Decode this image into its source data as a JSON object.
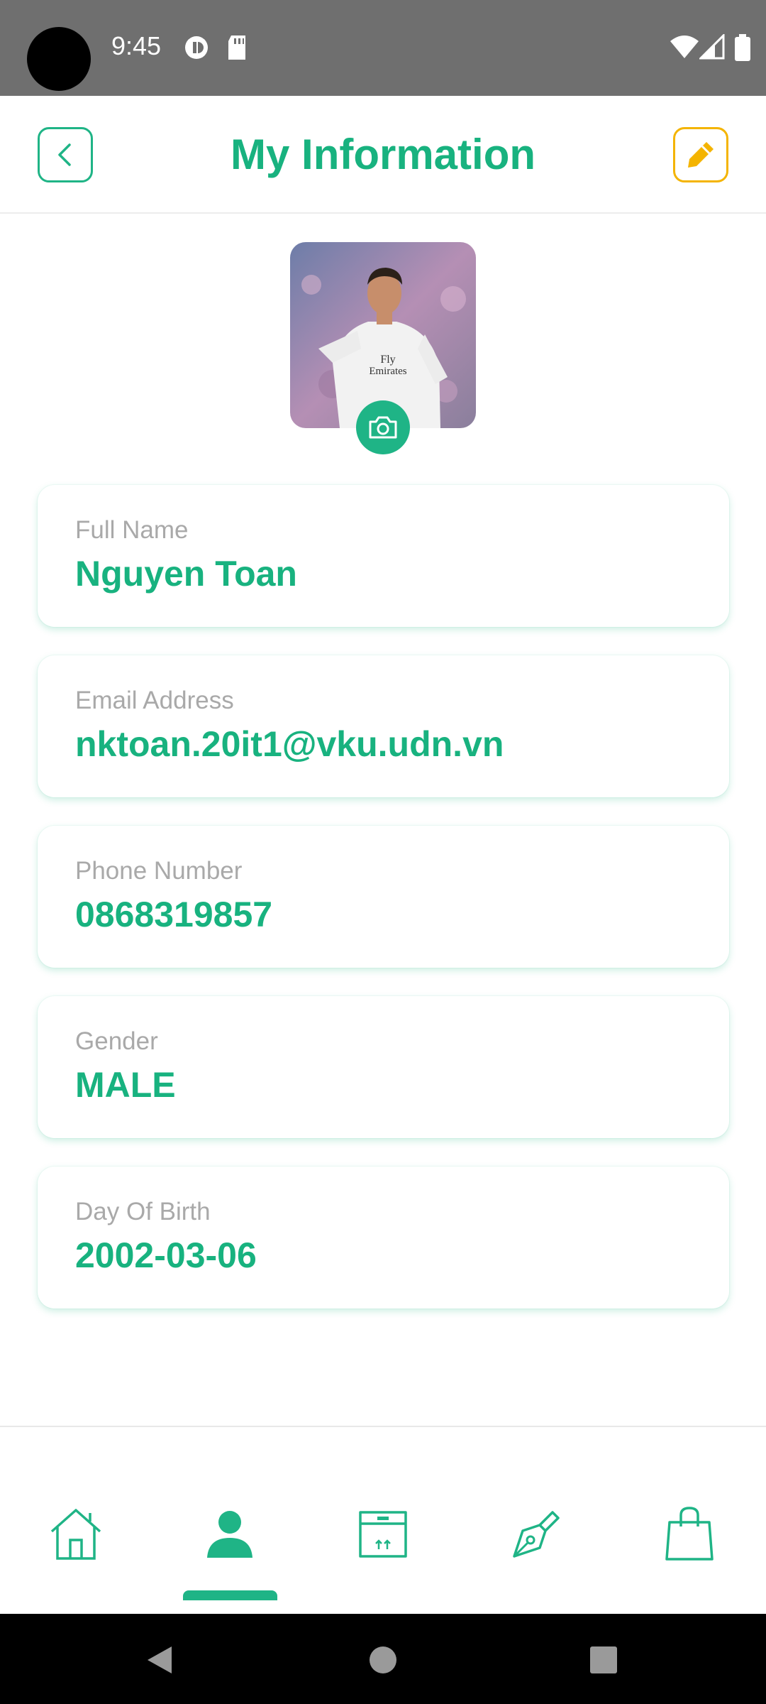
{
  "status_bar": {
    "time": "9:45"
  },
  "header": {
    "title": "My Information",
    "back_icon": "chevron-left-icon",
    "edit_icon": "pencil-icon"
  },
  "profile": {
    "avatar_alt": "Profile photo",
    "camera_icon": "camera-icon"
  },
  "fields": [
    {
      "label": "Full Name",
      "value": "Nguyen Toan"
    },
    {
      "label": "Email Address",
      "value": "nktoan.20it1@vku.udn.vn"
    },
    {
      "label": "Phone Number",
      "value": "0868319857"
    },
    {
      "label": "Gender",
      "value": "MALE"
    },
    {
      "label": "Day Of Birth",
      "value": "2002-03-06"
    }
  ],
  "bottom_nav": {
    "items": [
      "home-icon",
      "profile-icon",
      "box-icon",
      "pen-nib-icon",
      "shopping-bag-icon"
    ],
    "active_index": 1
  },
  "colors": {
    "accent": "#1fb486",
    "edit": "#f4b400",
    "label": "#a9a9a9"
  }
}
